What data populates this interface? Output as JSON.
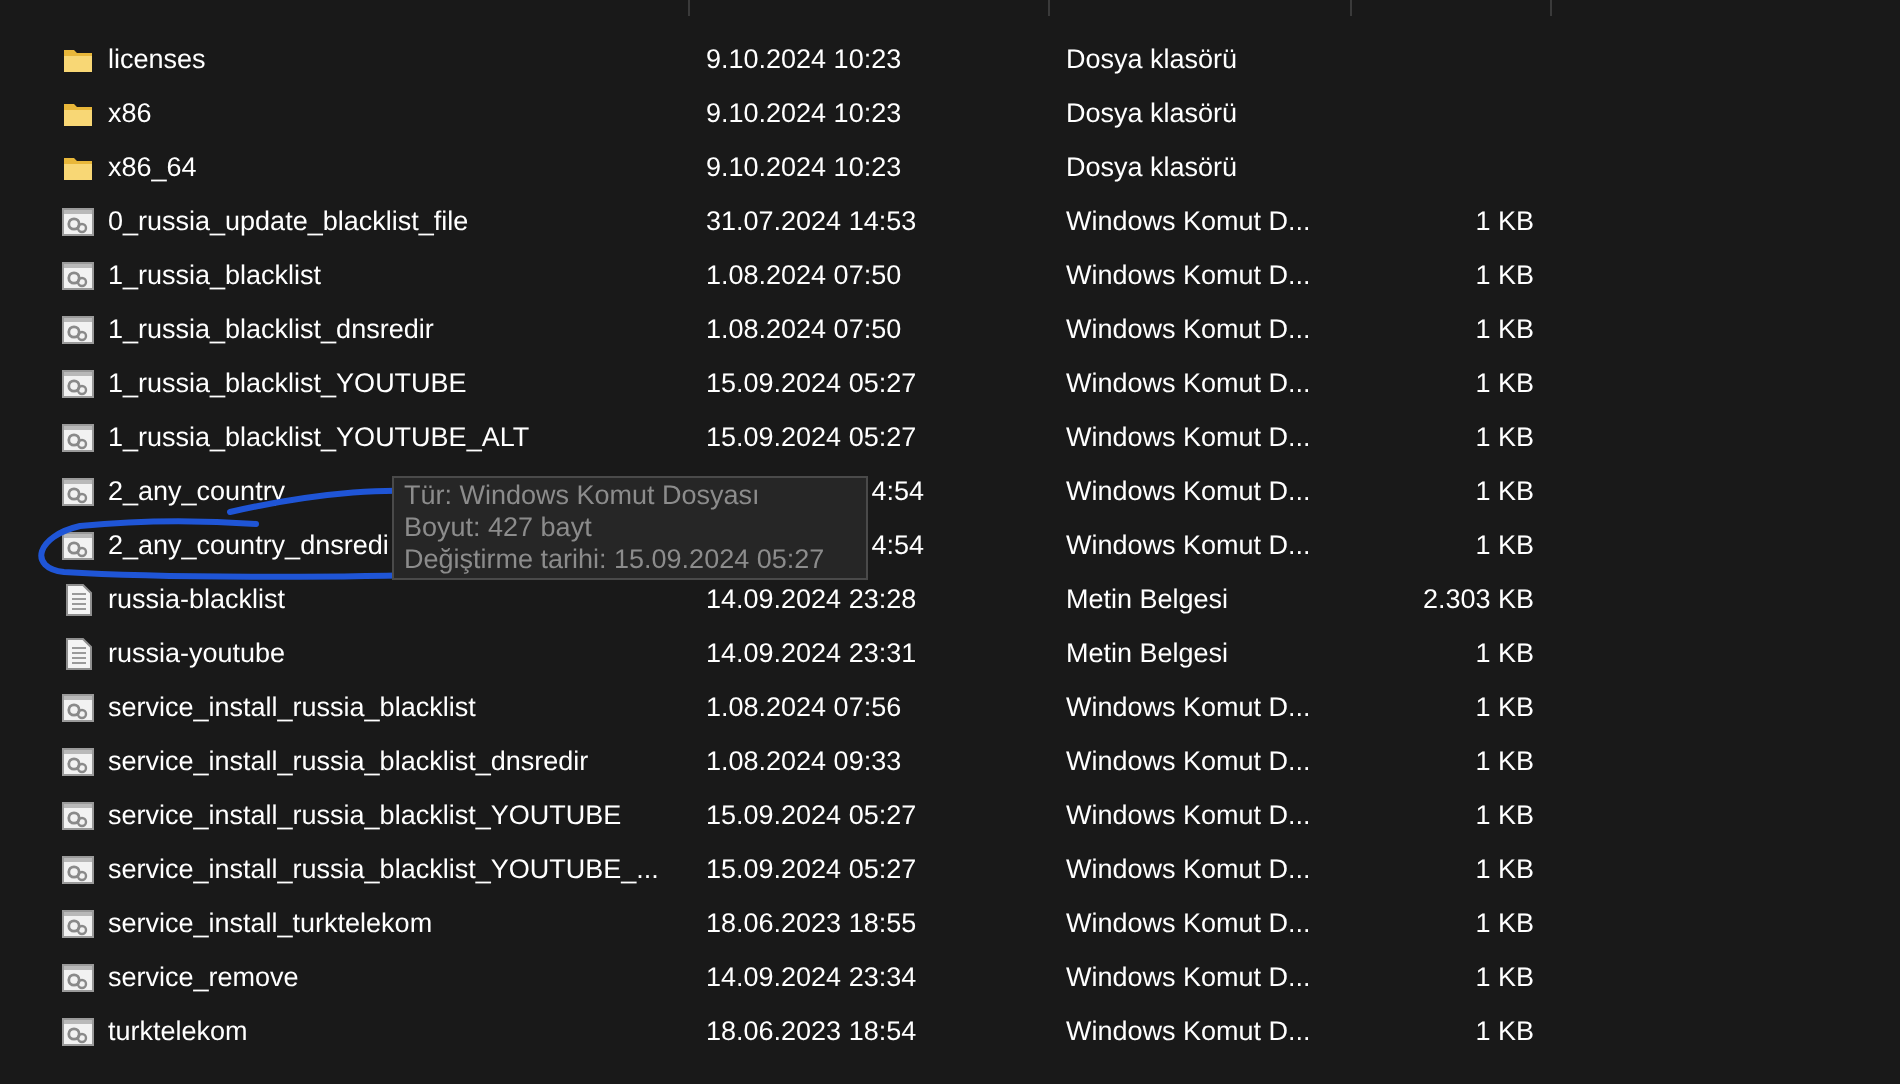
{
  "files": [
    {
      "kind": "folder",
      "name": "licenses",
      "date": "9.10.2024 10:23",
      "type": "Dosya klasörü"
    },
    {
      "kind": "folder",
      "name": "x86",
      "date": "9.10.2024 10:23",
      "type": "Dosya klasörü"
    },
    {
      "kind": "folder",
      "name": "x86_64",
      "date": "9.10.2024 10:23",
      "type": "Dosya klasörü"
    },
    {
      "kind": "script",
      "name": "0_russia_update_blacklist_file",
      "date": "31.07.2024 14:53",
      "type": "Windows Komut D...",
      "size": "1 KB"
    },
    {
      "kind": "script",
      "name": "1_russia_blacklist",
      "date": "1.08.2024 07:50",
      "type": "Windows Komut D...",
      "size": "1 KB"
    },
    {
      "kind": "script",
      "name": "1_russia_blacklist_dnsredir",
      "date": "1.08.2024 07:50",
      "type": "Windows Komut D...",
      "size": "1 KB"
    },
    {
      "kind": "script",
      "name": "1_russia_blacklist_YOUTUBE",
      "date": "15.09.2024 05:27",
      "type": "Windows Komut D...",
      "size": "1 KB"
    },
    {
      "kind": "script",
      "name": "1_russia_blacklist_YOUTUBE_ALT",
      "date": "15.09.2024 05:27",
      "type": "Windows Komut D...",
      "size": "1 KB"
    },
    {
      "kind": "script",
      "name": "2_any_country",
      "date": "4:54",
      "date_covered": true,
      "type": "Windows Komut D...",
      "size": "1 KB"
    },
    {
      "kind": "script",
      "name": "2_any_country_dnsredi",
      "date": "4:54",
      "date_covered": true,
      "type": "Windows Komut D...",
      "size": "1 KB"
    },
    {
      "kind": "text",
      "name": "russia-blacklist",
      "date": "14.09.2024 23:28",
      "type": "Metin Belgesi",
      "size": "2.303 KB"
    },
    {
      "kind": "text",
      "name": "russia-youtube",
      "date": "14.09.2024 23:31",
      "type": "Metin Belgesi",
      "size": "1 KB"
    },
    {
      "kind": "script",
      "name": "service_install_russia_blacklist",
      "date": "1.08.2024 07:56",
      "type": "Windows Komut D...",
      "size": "1 KB"
    },
    {
      "kind": "script",
      "name": "service_install_russia_blacklist_dnsredir",
      "date": "1.08.2024 09:33",
      "type": "Windows Komut D...",
      "size": "1 KB"
    },
    {
      "kind": "script",
      "name": "service_install_russia_blacklist_YOUTUBE",
      "date": "15.09.2024 05:27",
      "type": "Windows Komut D...",
      "size": "1 KB"
    },
    {
      "kind": "script",
      "name": "service_install_russia_blacklist_YOUTUBE_...",
      "date": "15.09.2024 05:27",
      "type": "Windows Komut D...",
      "size": "1 KB"
    },
    {
      "kind": "script",
      "name": "service_install_turktelekom",
      "date": "18.06.2023 18:55",
      "type": "Windows Komut D...",
      "size": "1 KB"
    },
    {
      "kind": "script",
      "name": "service_remove",
      "date": "14.09.2024 23:34",
      "type": "Windows Komut D...",
      "size": "1 KB"
    },
    {
      "kind": "script",
      "name": "turktelekom",
      "date": "18.06.2023 18:54",
      "type": "Windows Komut D...",
      "size": "1 KB"
    }
  ],
  "tooltip": {
    "lines": [
      "Tür: Windows Komut Dosyası",
      "Boyut: 427 bayt",
      "Değiştirme tarihi: 15.09.2024 05:27"
    ]
  },
  "annotation": {
    "kind": "ink-loop"
  }
}
